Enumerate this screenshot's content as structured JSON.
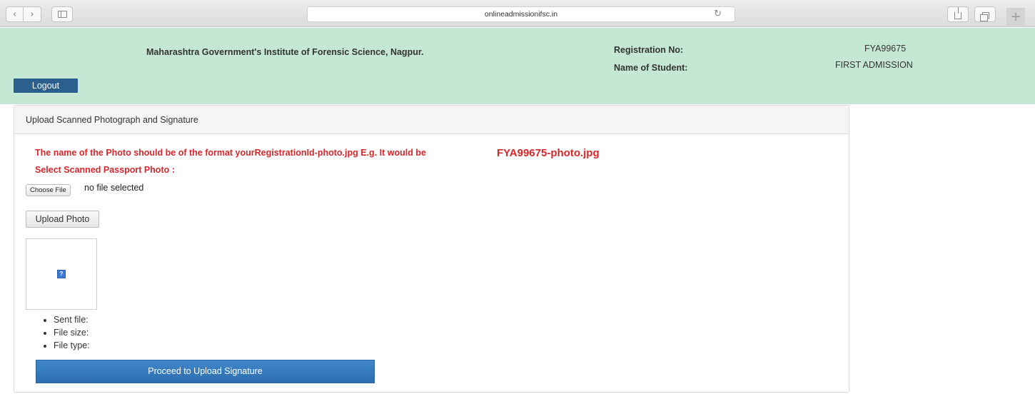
{
  "browser": {
    "url": "onlineadmissionifsc.in",
    "back_icon": "chevron-left-icon",
    "forward_icon": "chevron-right-icon",
    "reload_icon": "reload-icon",
    "plus_label": "+"
  },
  "header": {
    "institute_title": "Maharashtra Government's Institute of Forensic Science, Nagpur.",
    "registration_label": "Registration No:",
    "registration_value": "FYA99675",
    "student_label": "Name of Student:",
    "student_value": "FIRST ADMISSION",
    "logout_label": "Logout",
    "background_color": "#c5e8d5",
    "logout_color": "#2b5f8e"
  },
  "panel": {
    "heading": "Upload Scanned Photograph and Signature",
    "format_note": "The name of the Photo should be of the format yourRegistrationId-photo.jpg E.g. It would be",
    "format_example": "FYA99675-photo.jpg",
    "select_label": "Select Scanned Passport Photo :",
    "choose_file_label": "Choose File",
    "no_file_text": "no file selected",
    "upload_photo_label": "Upload Photo",
    "file_info": [
      "Sent file:",
      "File size:",
      "File type:"
    ],
    "proceed_label": "Proceed to Upload Signature",
    "warning_color": "#d9262a",
    "proceed_color": "#337ab7"
  }
}
